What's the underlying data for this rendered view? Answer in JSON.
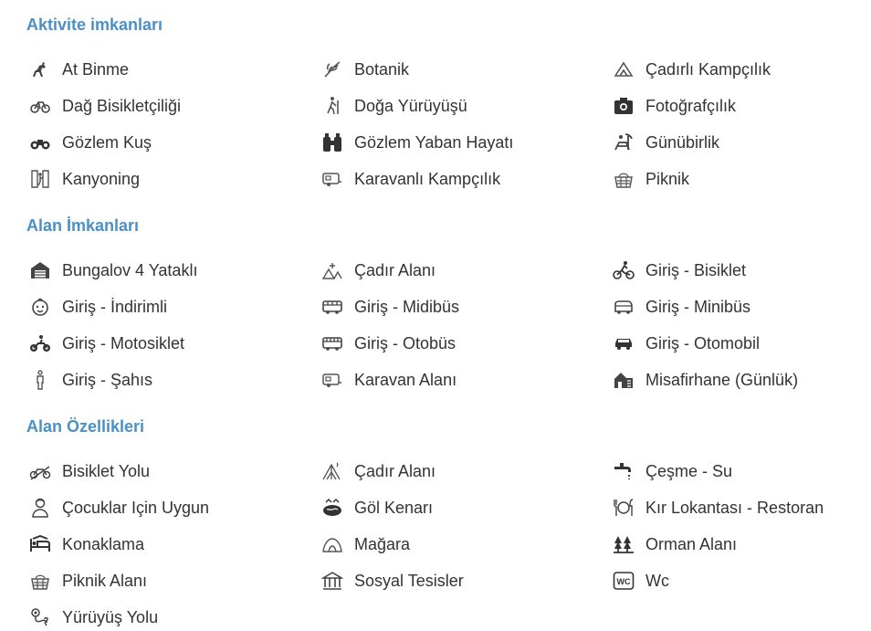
{
  "sections": [
    {
      "title": "Aktivite imkanları",
      "items": [
        {
          "label": "At Binme",
          "icon": "horse-riding-icon"
        },
        {
          "label": "Botanik",
          "icon": "leaf-icon"
        },
        {
          "label": "Çadırlı Kampçılık",
          "icon": "tent-icon"
        },
        {
          "label": "Dağ Bisikletçiliği",
          "icon": "bicycle-icon"
        },
        {
          "label": "Doğa Yürüyüşü",
          "icon": "hiker-icon"
        },
        {
          "label": "Fotoğrafçılık",
          "icon": "camera-icon"
        },
        {
          "label": "Gözlem Kuş",
          "icon": "binoculars-icon"
        },
        {
          "label": "Gözlem Yaban Hayatı",
          "icon": "binoculars-large-icon"
        },
        {
          "label": "Günübirlik",
          "icon": "beach-chair-icon"
        },
        {
          "label": "Kanyoning",
          "icon": "canyoning-icon"
        },
        {
          "label": "Karavanlı Kampçılık",
          "icon": "caravan-icon"
        },
        {
          "label": "Piknik",
          "icon": "picnic-basket-icon"
        }
      ]
    },
    {
      "title": "Alan İmkanları",
      "items": [
        {
          "label": "Bungalov 4 Yataklı",
          "icon": "bungalow-icon"
        },
        {
          "label": "Çadır Alanı",
          "icon": "camp-area-icon"
        },
        {
          "label": "Giriş - Bisiklet",
          "icon": "cyclist-icon"
        },
        {
          "label": "Giriş - İndirimli",
          "icon": "child-face-icon"
        },
        {
          "label": "Giriş - Midibüs",
          "icon": "midibus-icon"
        },
        {
          "label": "Giriş - Minibüs",
          "icon": "minibus-icon"
        },
        {
          "label": "Giriş - Motosiklet",
          "icon": "motorcycle-icon"
        },
        {
          "label": "Giriş - Otobüs",
          "icon": "bus-icon"
        },
        {
          "label": "Giriş - Otomobil",
          "icon": "car-icon"
        },
        {
          "label": "Giriş - Şahıs",
          "icon": "person-icon"
        },
        {
          "label": "Karavan Alanı",
          "icon": "caravan-icon"
        },
        {
          "label": "Misafirhane (Günlük)",
          "icon": "guesthouse-icon"
        }
      ]
    },
    {
      "title": "Alan Özellikleri",
      "items": [
        {
          "label": "Bisiklet Yolu",
          "icon": "bike-path-icon"
        },
        {
          "label": "Çadır Alanı",
          "icon": "tent-outline-icon"
        },
        {
          "label": "Çeşme - Su",
          "icon": "faucet-icon"
        },
        {
          "label": "Çocuklar Için Uygun",
          "icon": "child-icon"
        },
        {
          "label": "Göl Kenarı",
          "icon": "lake-icon"
        },
        {
          "label": "Kır Lokantası - Restoran",
          "icon": "restaurant-icon"
        },
        {
          "label": "Konaklama",
          "icon": "bed-icon"
        },
        {
          "label": "Mağara",
          "icon": "cave-icon"
        },
        {
          "label": "Orman Alanı",
          "icon": "forest-icon"
        },
        {
          "label": "Piknik Alanı",
          "icon": "picnic-basket-icon"
        },
        {
          "label": "Sosyal Tesisler",
          "icon": "social-facility-icon"
        },
        {
          "label": "Wc",
          "icon": "wc-icon"
        },
        {
          "label": "Yürüyüş Yolu",
          "icon": "walking-path-icon"
        }
      ]
    }
  ],
  "colors": {
    "heading": "#4a90c8",
    "text": "#333333",
    "icon": "#444444"
  }
}
